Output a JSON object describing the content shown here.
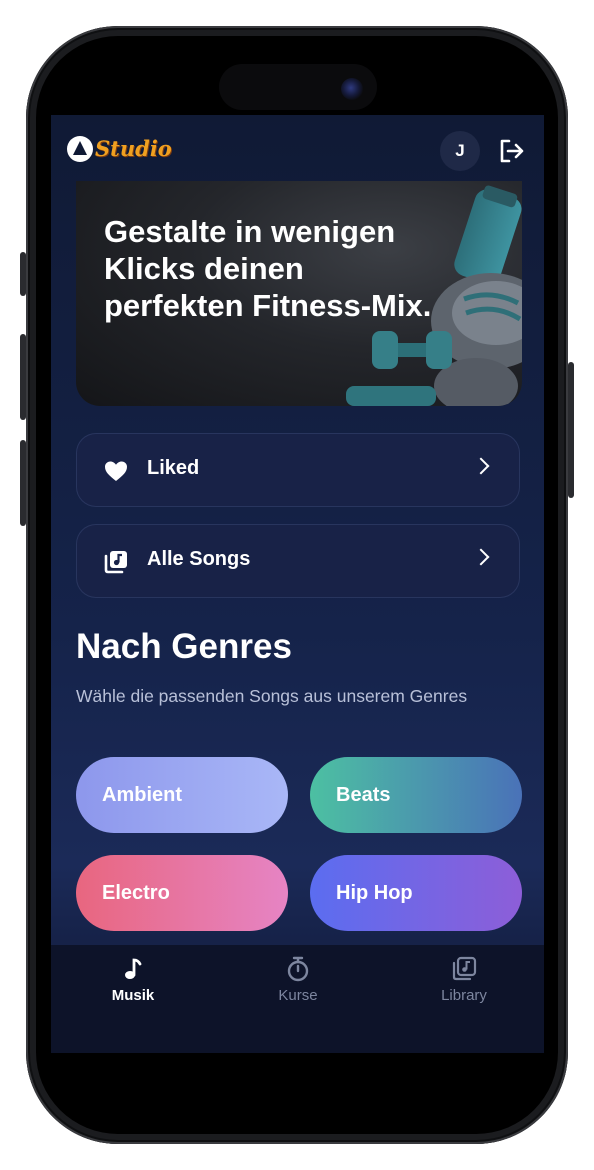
{
  "header": {
    "logo_text": "Studio",
    "avatar_initial": "J"
  },
  "hero": {
    "title": "Gestalte in wenigen Klicks deinen perfekten Fitness-Mix."
  },
  "quick_links": [
    {
      "label": "Liked",
      "icon": "heart-icon"
    },
    {
      "label": "Alle Songs",
      "icon": "music-library-icon"
    }
  ],
  "genres": {
    "title": "Nach Genres",
    "subtitle": "Wähle die passenden Songs aus unserem Genres",
    "items": [
      {
        "label": "Ambient",
        "colors": [
          "#8d97ec",
          "#a9b7f7"
        ]
      },
      {
        "label": "Beats",
        "colors": [
          "#4cc0a2",
          "#4a72b8"
        ]
      },
      {
        "label": "Electro",
        "colors": [
          "#e8667f",
          "#e684c4"
        ]
      },
      {
        "label": "Hip Hop",
        "colors": [
          "#5b6df0",
          "#8d5ed8"
        ]
      }
    ]
  },
  "tabs": [
    {
      "label": "Musik",
      "icon": "music-note-icon",
      "active": true
    },
    {
      "label": "Kurse",
      "icon": "stopwatch-icon",
      "active": false
    },
    {
      "label": "Library",
      "icon": "library-icon",
      "active": false
    }
  ],
  "colors": {
    "background": "#13204a",
    "accent_logo": "#f0a020",
    "tab_active": "#ffffff",
    "tab_inactive": "#7d869f"
  }
}
